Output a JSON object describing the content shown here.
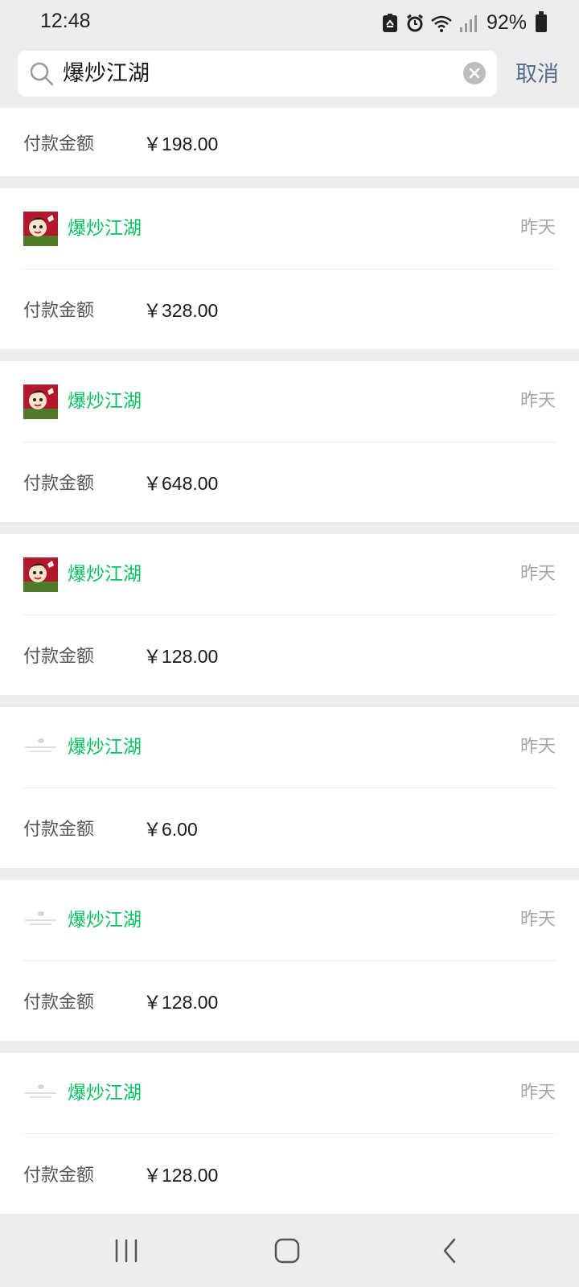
{
  "status_bar": {
    "time": "12:48",
    "battery": "92%"
  },
  "search": {
    "query": "爆炒江湖",
    "cancel_label": "取消"
  },
  "results": [
    {
      "name": "",
      "date": "",
      "amount_label": "付款金额",
      "amount": "￥198.00",
      "icon": "none"
    },
    {
      "name": "爆炒江湖",
      "date": "昨天",
      "amount_label": "付款金额",
      "amount": "￥328.00",
      "icon": "game-app-icon"
    },
    {
      "name": "爆炒江湖",
      "date": "昨天",
      "amount_label": "付款金额",
      "amount": "￥648.00",
      "icon": "game-app-icon"
    },
    {
      "name": "爆炒江湖",
      "date": "昨天",
      "amount_label": "付款金额",
      "amount": "￥128.00",
      "icon": "game-app-icon"
    },
    {
      "name": "爆炒江湖",
      "date": "昨天",
      "amount_label": "付款金额",
      "amount": "￥6.00",
      "icon": "placeholder-icon"
    },
    {
      "name": "爆炒江湖",
      "date": "昨天",
      "amount_label": "付款金额",
      "amount": "￥128.00",
      "icon": "placeholder-icon"
    },
    {
      "name": "爆炒江湖",
      "date": "昨天",
      "amount_label": "付款金额",
      "amount": "￥128.00",
      "icon": "placeholder-icon"
    }
  ],
  "colors": {
    "accent_green": "#07c160",
    "link_blue": "#576b95",
    "background": "#ededed"
  }
}
